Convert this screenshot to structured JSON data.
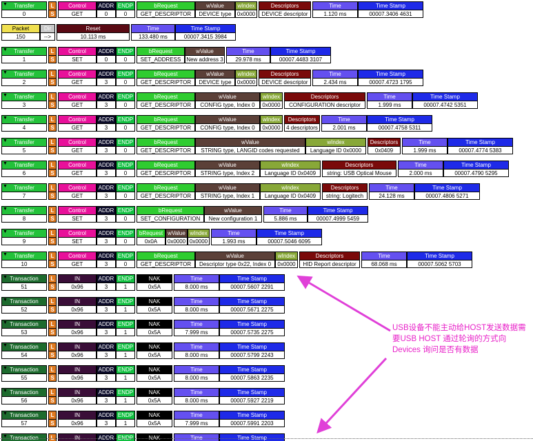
{
  "headers": {
    "transfer": "Transfer",
    "transaction": "Transaction",
    "packet": "Packet",
    "l": "L",
    "s": "S",
    "control": "Control",
    "addr": "ADDR",
    "endp": "ENDP",
    "brequest": "bRequest",
    "wvalue": "wValue",
    "windex": "wIndex",
    "descriptors": "Descriptors",
    "time": "Time",
    "timestamp": "Time Stamp",
    "reset": "Reset",
    "dir": "Dir",
    "in": "IN",
    "nak": "NAK"
  },
  "fold_glyph": "▼",
  "packet": {
    "number": "150",
    "dir": "-->",
    "reset": "10.113 ms",
    "time": "133.480 ms",
    "stamp": "00007.3415 3984"
  },
  "transfers": [
    {
      "n": "0",
      "ctl": "GET",
      "addr": "0",
      "endp": "0",
      "breq": "GET_DESCRIPTOR",
      "wvalue": "DEVICE type",
      "windex": "0x0000",
      "desc": "DEVICE descriptor",
      "time": "1.120 ms",
      "stamp": "00007.3406 4631"
    },
    {
      "n": "1",
      "ctl": "SET",
      "addr": "0",
      "endp": "0",
      "breq": "SET_ADDRESS",
      "wvalue": "New address 3",
      "time": "29.978 ms",
      "stamp": "00007.4483 3107"
    },
    {
      "n": "2",
      "ctl": "GET",
      "addr": "3",
      "endp": "0",
      "breq": "GET_DESCRIPTOR",
      "wvalue": "DEVICE type",
      "windex": "0x0000",
      "desc": "DEVICE descriptor",
      "time": "2.434 ms",
      "stamp": "00007.4723 1795"
    },
    {
      "n": "3",
      "ctl": "GET",
      "addr": "3",
      "endp": "0",
      "breq": "GET_DESCRIPTOR",
      "wvalue": "CONFIG type, Index 0",
      "windex": "0x0000",
      "desc": "CONFIGURATION descriptor",
      "time": "1.999 ms",
      "stamp": "00007.4742 5351"
    },
    {
      "n": "4",
      "ctl": "GET",
      "addr": "3",
      "endp": "0",
      "breq": "GET_DESCRIPTOR",
      "wvalue": "CONFIG type, Index 0",
      "windex": "0x0000",
      "desc": "4 descriptors",
      "time": "2.001 ms",
      "stamp": "00007.4758 5311"
    },
    {
      "n": "5",
      "ctl": "GET",
      "addr": "3",
      "endp": "0",
      "breq": "GET_DESCRIPTOR",
      "wvalue": "STRING type, LANGID codes requested",
      "windex": "Language ID 0x0000",
      "desc": "0x0409",
      "time": "1.999 ms",
      "stamp": "00007.4774 5383"
    },
    {
      "n": "6",
      "ctl": "GET",
      "addr": "3",
      "endp": "0",
      "breq": "GET_DESCRIPTOR",
      "wvalue": "STRING type, Index 2",
      "windex": "Language ID 0x0409",
      "desc": "string: USB Optical Mouse",
      "time": "2.000 ms",
      "stamp": "00007.4790 5295"
    },
    {
      "n": "7",
      "ctl": "GET",
      "addr": "3",
      "endp": "0",
      "breq": "GET_DESCRIPTOR",
      "wvalue": "STRING type, Index 1",
      "windex": "Language ID 0x0409",
      "desc": "string: Logitech",
      "time": "24.128 ms",
      "stamp": "00007.4806 5271"
    },
    {
      "n": "8",
      "ctl": "SET",
      "addr": "3",
      "endp": "0",
      "breq": "SET_CONFIGURATION",
      "wvalue": "New configuration 1",
      "time": "5.886 ms",
      "stamp": "00007.4999 5459"
    },
    {
      "n": "9",
      "ctl": "SET",
      "addr": "3",
      "endp": "0",
      "breq": "0x0A",
      "wvalue": "0x0000",
      "windex": "0x0000",
      "time": "1.993 ms",
      "stamp": "00007.5046 6095"
    },
    {
      "n": "10",
      "ctl": "GET",
      "addr": "3",
      "endp": "0",
      "breq": "GET_DESCRIPTOR",
      "wvalue": "Descriptor type 0x22, Index 0",
      "windex": "0x0000",
      "desc": "HID Report descriptor",
      "time": "68.068 ms",
      "stamp": "00007.5062 5703"
    }
  ],
  "transactions": [
    {
      "n": "51",
      "in": "0x96",
      "addr": "3",
      "endp": "1",
      "nak": "0x5A",
      "time": "8.000 ms",
      "stamp": "00007.5607 2291"
    },
    {
      "n": "52",
      "in": "0x96",
      "addr": "3",
      "endp": "1",
      "nak": "0x5A",
      "time": "8.000 ms",
      "stamp": "00007.5671 2275"
    },
    {
      "n": "53",
      "in": "0x96",
      "addr": "3",
      "endp": "1",
      "nak": "0x5A",
      "time": "7.999 ms",
      "stamp": "00007.5735 2275"
    },
    {
      "n": "54",
      "in": "0x96",
      "addr": "3",
      "endp": "1",
      "nak": "0x5A",
      "time": "8.000 ms",
      "stamp": "00007.5799 2243"
    },
    {
      "n": "55",
      "in": "0x96",
      "addr": "3",
      "endp": "1",
      "nak": "0x5A",
      "time": "8.000 ms",
      "stamp": "00007.5863 2235"
    },
    {
      "n": "56",
      "in": "0x96",
      "addr": "3",
      "endp": "1",
      "nak": "0x5A",
      "time": "8.000 ms",
      "stamp": "00007.5927 2219"
    },
    {
      "n": "57",
      "in": "0x96",
      "addr": "3",
      "endp": "1",
      "nak": "0x5A",
      "time": "7.999 ms",
      "stamp": "00007.5991 2203"
    },
    {
      "n": "",
      "in": "",
      "addr": "",
      "endp": "",
      "nak": "",
      "time": "",
      "stamp": ""
    }
  ],
  "annotation": {
    "text": "USB设备不能主动给HOST发送数据需要USB HOST 通过轮询的方式向Devices 询问是否有数据",
    "color": "#e820c8"
  }
}
